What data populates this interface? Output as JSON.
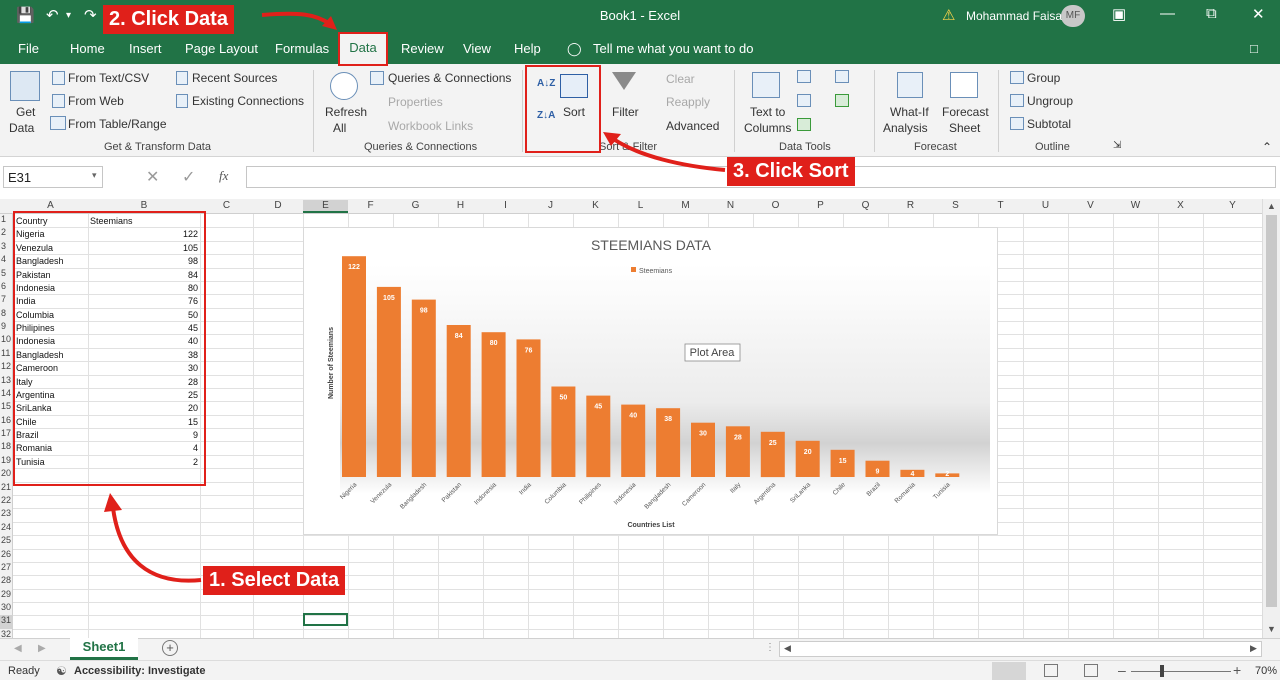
{
  "titlebar": {
    "doc_title": "Book1  -  Excel",
    "user": "Mohammad Faisal",
    "initials": "MF"
  },
  "tabs": [
    "File",
    "Home",
    "Insert",
    "Page Layout",
    "Formulas",
    "Data",
    "Review",
    "View",
    "Help"
  ],
  "tell_me": "Tell me what you want to do",
  "ribbon": {
    "get_data": [
      "Get",
      "Data"
    ],
    "from_text": "From Text/CSV",
    "from_web": "From Web",
    "from_table": "From Table/Range",
    "recent_sources": "Recent Sources",
    "existing_connections": "Existing Connections",
    "group_get_transform": "Get & Transform Data",
    "refresh": [
      "Refresh",
      "All"
    ],
    "queries_connections": "Queries & Connections",
    "properties": "Properties",
    "workbook_links": "Workbook Links",
    "group_queries": "Queries & Connections",
    "sort": "Sort",
    "filter": "Filter",
    "clear": "Clear",
    "reapply": "Reapply",
    "advanced": "Advanced",
    "group_sort": "Sort & Filter",
    "text_to_columns": [
      "Text to",
      "Columns"
    ],
    "group_data_tools": "Data Tools",
    "what_if": [
      "What-If",
      "Analysis"
    ],
    "forecast_sheet": [
      "Forecast",
      "Sheet"
    ],
    "group_forecast": "Forecast",
    "group_btn": "Group",
    "ungroup_btn": "Ungroup",
    "subtotal": "Subtotal",
    "group_outline": "Outline"
  },
  "formula_bar": {
    "name_box": "E31",
    "fx": "fx"
  },
  "columns": [
    "A",
    "B",
    "C",
    "D",
    "E",
    "F",
    "G",
    "H",
    "I",
    "J",
    "K",
    "L",
    "M",
    "N",
    "O",
    "P",
    "Q",
    "R",
    "S",
    "T",
    "U",
    "V",
    "W",
    "X",
    "Y"
  ],
  "rows": [
    "1",
    "2",
    "3",
    "4",
    "5",
    "6",
    "7",
    "8",
    "9",
    "10",
    "11",
    "12",
    "13",
    "14",
    "15",
    "16",
    "17",
    "18",
    "19",
    "20",
    "21",
    "22",
    "23",
    "24",
    "25",
    "26",
    "27",
    "28",
    "29",
    "30",
    "31",
    "32"
  ],
  "table": {
    "headers": [
      "Country",
      "Steemians"
    ],
    "rows": [
      [
        "Nigeria",
        "122"
      ],
      [
        "Venezula",
        "105"
      ],
      [
        "Bangladesh",
        "98"
      ],
      [
        "Pakistan",
        "84"
      ],
      [
        "Indonesia",
        "80"
      ],
      [
        "India",
        "76"
      ],
      [
        "Columbia",
        "50"
      ],
      [
        "Philipines",
        "45"
      ],
      [
        "Indonesia",
        "40"
      ],
      [
        "Bangladesh",
        "38"
      ],
      [
        "Cameroon",
        "30"
      ],
      [
        "Italy",
        "28"
      ],
      [
        "Argentina",
        "25"
      ],
      [
        "SriLanka",
        "20"
      ],
      [
        "Chile",
        "15"
      ],
      [
        "Brazil",
        "9"
      ],
      [
        "Romania",
        "4"
      ],
      [
        "Tunisia",
        "2"
      ]
    ]
  },
  "chart_data": {
    "type": "bar",
    "title": "STEEMIANS DATA",
    "legend": "Steemians",
    "xlabel": "Countries List",
    "ylabel": "Number of Steemians",
    "tooltip": "Plot Area",
    "color": "#ed7d31",
    "categories": [
      "Nigeria",
      "Venezula",
      "Bangladesh",
      "Pakistan",
      "Indonesia",
      "India",
      "Columbia",
      "Philipines",
      "Indonesia",
      "Bangladesh",
      "Cameroon",
      "Italy",
      "Argentina",
      "SriLanka",
      "Chile",
      "Brazil",
      "Romania",
      "Tunisia"
    ],
    "values": [
      122,
      105,
      98,
      84,
      80,
      76,
      50,
      45,
      40,
      38,
      30,
      28,
      25,
      20,
      15,
      9,
      4,
      2
    ],
    "ylim": [
      0,
      130
    ]
  },
  "annotations": {
    "select": "1. Select Data",
    "click_data": "2. Click Data",
    "click_sort": "3. Click Sort"
  },
  "sheet_tab": "Sheet1",
  "status": {
    "ready": "Ready",
    "accessibility": "Accessibility: Investigate",
    "zoom": "70%"
  }
}
